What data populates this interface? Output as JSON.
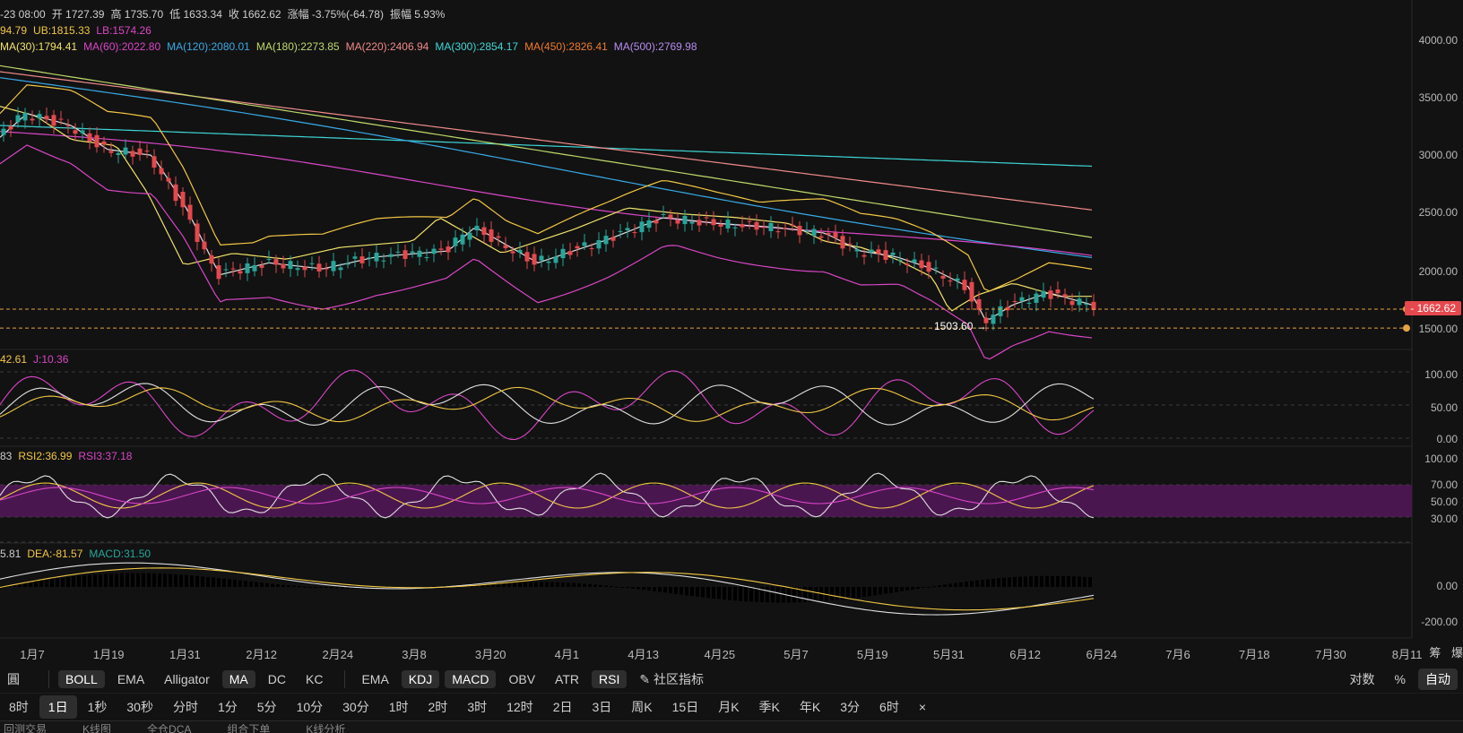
{
  "header": {
    "line1": [
      {
        "text": "-23 08:00",
        "color": "#cfcfcf"
      },
      {
        "text": "开 1727.39",
        "color": "#cfcfcf"
      },
      {
        "text": "高 1735.70",
        "color": "#cfcfcf"
      },
      {
        "text": "低 1633.34",
        "color": "#cfcfcf"
      },
      {
        "text": "收 1662.62",
        "color": "#cfcfcf"
      },
      {
        "text": "涨幅 -3.75%(-64.78)",
        "color": "#cfcfcf"
      },
      {
        "text": "振幅 5.93%",
        "color": "#cfcfcf"
      }
    ],
    "line2": [
      {
        "text": "94.79",
        "color": "#f2c744"
      },
      {
        "text": "UB:1815.33",
        "color": "#f2c744"
      },
      {
        "text": "LB:1574.26",
        "color": "#d946c7"
      }
    ],
    "line3": [
      {
        "text": "MA(30):1794.41",
        "color": "#f2e36b"
      },
      {
        "text": "MA(60):2022.80",
        "color": "#d946c7"
      },
      {
        "text": "MA(120):2080.01",
        "color": "#38a9e6"
      },
      {
        "text": "MA(180):2273.85",
        "color": "#bfd86b"
      },
      {
        "text": "MA(220):2406.94",
        "color": "#f08a8a"
      },
      {
        "text": "MA(300):2854.17",
        "color": "#3fd6d6"
      },
      {
        "text": "MA(450):2826.41",
        "color": "#f07a2a"
      },
      {
        "text": "MA(500):2769.98",
        "color": "#b58cf0"
      }
    ]
  },
  "kdj_info": [
    {
      "text": "42.61",
      "color": "#f2c744"
    },
    {
      "text": "J:10.36",
      "color": "#d946c7"
    }
  ],
  "rsi_info": [
    {
      "text": "83",
      "color": "#cfcfcf"
    },
    {
      "text": "RSI2:36.99",
      "color": "#f2c744"
    },
    {
      "text": "RSI3:37.18",
      "color": "#d946c7"
    }
  ],
  "macd_info": [
    {
      "text": "5.81",
      "color": "#cfcfcf"
    },
    {
      "text": "DEA:-81.57",
      "color": "#f2c744"
    },
    {
      "text": "MACD:31.50",
      "color": "#26a69a"
    }
  ],
  "price_axis": [
    "4000.00",
    "3500.00",
    "3000.00",
    "2500.00",
    "2000.00",
    "1500.00"
  ],
  "kdj_axis": [
    "100.00",
    "50.00",
    "0.00"
  ],
  "rsi_axis": [
    "100.00",
    "70.00",
    "50.00",
    "30.00"
  ],
  "macd_axis": [
    "0.00",
    "-200.00"
  ],
  "current_price": "1662.62",
  "low_label": "1503.60",
  "x_axis": [
    "1月7",
    "1月19",
    "1月31",
    "2月12",
    "2月24",
    "3月8",
    "3月20",
    "4月1",
    "4月13",
    "4月25",
    "5月7",
    "5月19",
    "5月31",
    "6月12",
    "6月24",
    "7月6",
    "7月18",
    "7月30",
    "8月11"
  ],
  "side_buttons": [
    "筹",
    "爆"
  ],
  "indicators_main": [
    "BOLL",
    "EMA",
    "Alligator",
    "MA",
    "DC",
    "KC"
  ],
  "indicators_main_active": [
    "BOLL",
    "MA"
  ],
  "indicators_sub": [
    "EMA",
    "KDJ",
    "MACD",
    "OBV",
    "ATR",
    "RSI"
  ],
  "indicators_sub_active": [
    "KDJ",
    "MACD",
    "RSI"
  ],
  "community_label": "社区指标",
  "toolbar_right": [
    "对数",
    "%",
    "自动"
  ],
  "timeframes": [
    "8时",
    "1日",
    "1秒",
    "30秒",
    "分时",
    "1分",
    "5分",
    "10分",
    "30分",
    "1时",
    "2时",
    "3时",
    "12时",
    "2日",
    "3日",
    "周K",
    "15日",
    "月K",
    "季K",
    "年K",
    "3分",
    "6时"
  ],
  "active_timeframe": "1日",
  "close_x": "×",
  "bottom_strip": [
    "回测交易",
    "K线图",
    "全仓DCA",
    "组合下单",
    "K线分析"
  ],
  "colors": {
    "up": "#26a69a",
    "down": "#e5484d",
    "bg": "#121212",
    "grid": "#222222"
  },
  "chart_data": {
    "type": "candlestick",
    "price_ylim": [
      1400,
      4100
    ],
    "last_close": 1662.62,
    "low": 1503.6
  }
}
